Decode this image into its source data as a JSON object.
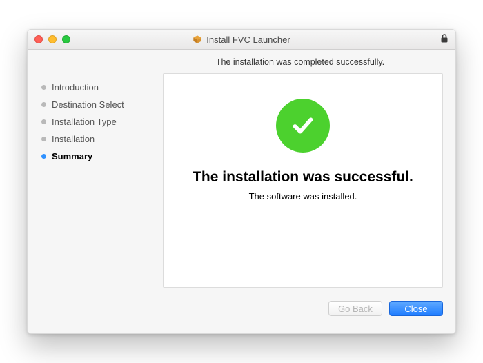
{
  "window": {
    "title": "Install FVC Launcher"
  },
  "subheader": "The installation was completed successfully.",
  "sidebar": {
    "steps": [
      {
        "label": "Introduction",
        "active": false
      },
      {
        "label": "Destination Select",
        "active": false
      },
      {
        "label": "Installation Type",
        "active": false
      },
      {
        "label": "Installation",
        "active": false
      },
      {
        "label": "Summary",
        "active": true
      }
    ]
  },
  "main": {
    "heading": "The installation was successful.",
    "subtext": "The software was installed."
  },
  "footer": {
    "go_back_label": "Go Back",
    "close_label": "Close"
  }
}
